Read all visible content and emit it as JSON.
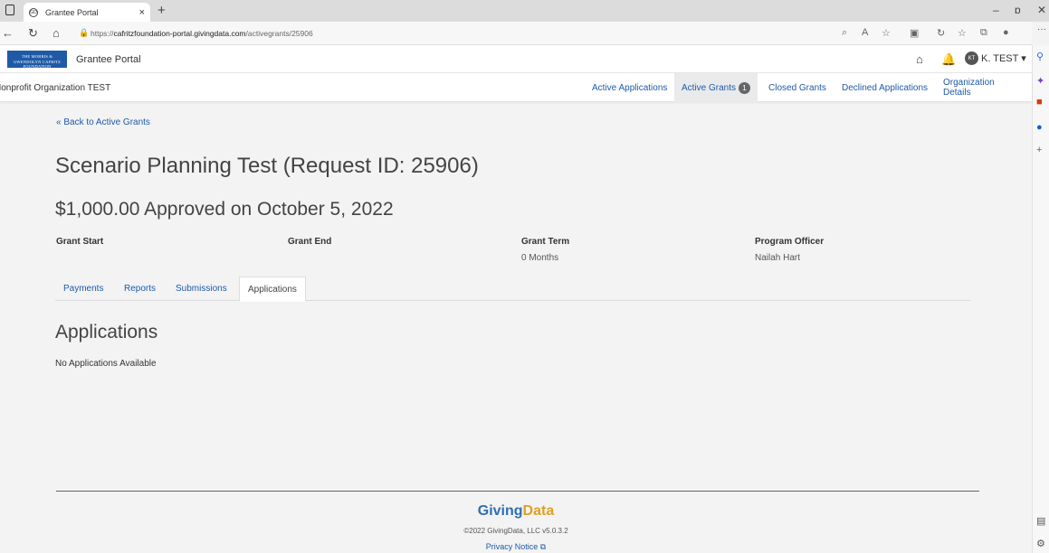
{
  "browser": {
    "tab_title": "Grantee Portal",
    "tab_close": "×",
    "new_tab": "+",
    "url_prefix": "https://",
    "url_host": "cafritzfoundation-portal.givingdata.com",
    "url_path": "/activegrants/25906",
    "window_min": "–",
    "window_restore": "ɒ",
    "window_close": "✕",
    "more_menu": "···"
  },
  "header": {
    "logo_text": "THE MORRIS & GWENDOLYN CAFRITZ FOUNDATION",
    "app_title": "Grantee Portal",
    "user_initials": "KT",
    "user_name": "K. TEST ▾"
  },
  "org_nav": {
    "org_name": "Nonprofit Organization TEST",
    "links": [
      {
        "label": "Active Applications"
      },
      {
        "label": "Active Grants",
        "badge": "1"
      },
      {
        "label": "Closed Grants"
      },
      {
        "label": "Declined Applications"
      },
      {
        "label": "Organization Details"
      }
    ]
  },
  "main": {
    "back_link": "« Back to Active Grants",
    "title": "Scenario Planning Test (Request ID: 25906)",
    "subtitle": "$1,000.00 Approved on October 5, 2022",
    "fields": [
      {
        "label": "Grant Start",
        "value": ""
      },
      {
        "label": "Grant End",
        "value": ""
      },
      {
        "label": "Grant Term",
        "value": "0 Months"
      },
      {
        "label": "Program Officer",
        "value": "Nailah Hart"
      }
    ],
    "tabs": [
      "Payments",
      "Reports",
      "Submissions",
      "Applications"
    ],
    "active_tab": "Applications",
    "section_title": "Applications",
    "empty_message": "No Applications Available"
  },
  "footer": {
    "logo_part1": "Giving",
    "logo_part2": "Data",
    "copyright": "©2022 GivingData, LLC v5.0.3.2",
    "privacy": "Privacy Notice ⧉"
  },
  "colors": {
    "link": "#1e5aa8",
    "brand_logo_bg": "#1f5aa6",
    "page_bg": "#f3f3f3"
  },
  "icons": [
    "home-icon",
    "bell-icon",
    "back-icon",
    "refresh-icon",
    "lock-icon",
    "external-link-icon"
  ]
}
